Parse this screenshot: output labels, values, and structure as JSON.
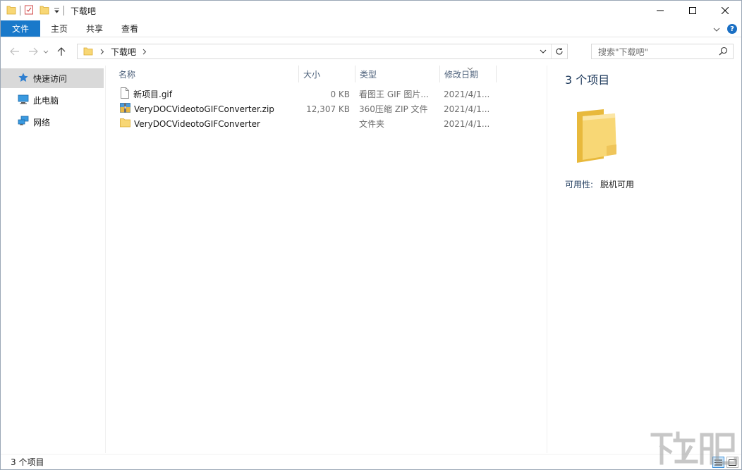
{
  "window": {
    "title": "下载吧"
  },
  "ribbon": {
    "tabs": [
      {
        "label": "文件",
        "active": true
      },
      {
        "label": "主页"
      },
      {
        "label": "共享"
      },
      {
        "label": "查看"
      }
    ],
    "help_label": "?"
  },
  "address": {
    "path": [
      "下载吧"
    ],
    "search_placeholder": "搜索\"下载吧\""
  },
  "navpane": {
    "items": [
      {
        "label": "快速访问",
        "icon": "star-icon",
        "selected": true
      },
      {
        "label": "此电脑",
        "icon": "computer-icon"
      },
      {
        "label": "网络",
        "icon": "network-icon"
      }
    ]
  },
  "filelist": {
    "columns": [
      "名称",
      "大小",
      "类型",
      "修改日期"
    ],
    "rows": [
      {
        "name": "新项目.gif",
        "size": "0 KB",
        "type": "看图王 GIF 图片...",
        "date": "2021/4/1...",
        "icon": "file-icon"
      },
      {
        "name": "VeryDOCVideotoGIFConverter.zip",
        "size": "12,307 KB",
        "type": "360压缩 ZIP 文件",
        "date": "2021/4/1...",
        "icon": "zip-icon"
      },
      {
        "name": "VeryDOCVideotoGIFConverter",
        "size": "",
        "type": "文件夹",
        "date": "2021/4/1...",
        "icon": "folder-icon"
      }
    ]
  },
  "details": {
    "count": "3 个项目",
    "availability_label": "可用性:",
    "availability_value": "脱机可用"
  },
  "statusbar": {
    "text": "3 个项目"
  },
  "colors": {
    "accent": "#1979ca",
    "folder": "#f8d775",
    "selection": "#d9d9d9"
  }
}
